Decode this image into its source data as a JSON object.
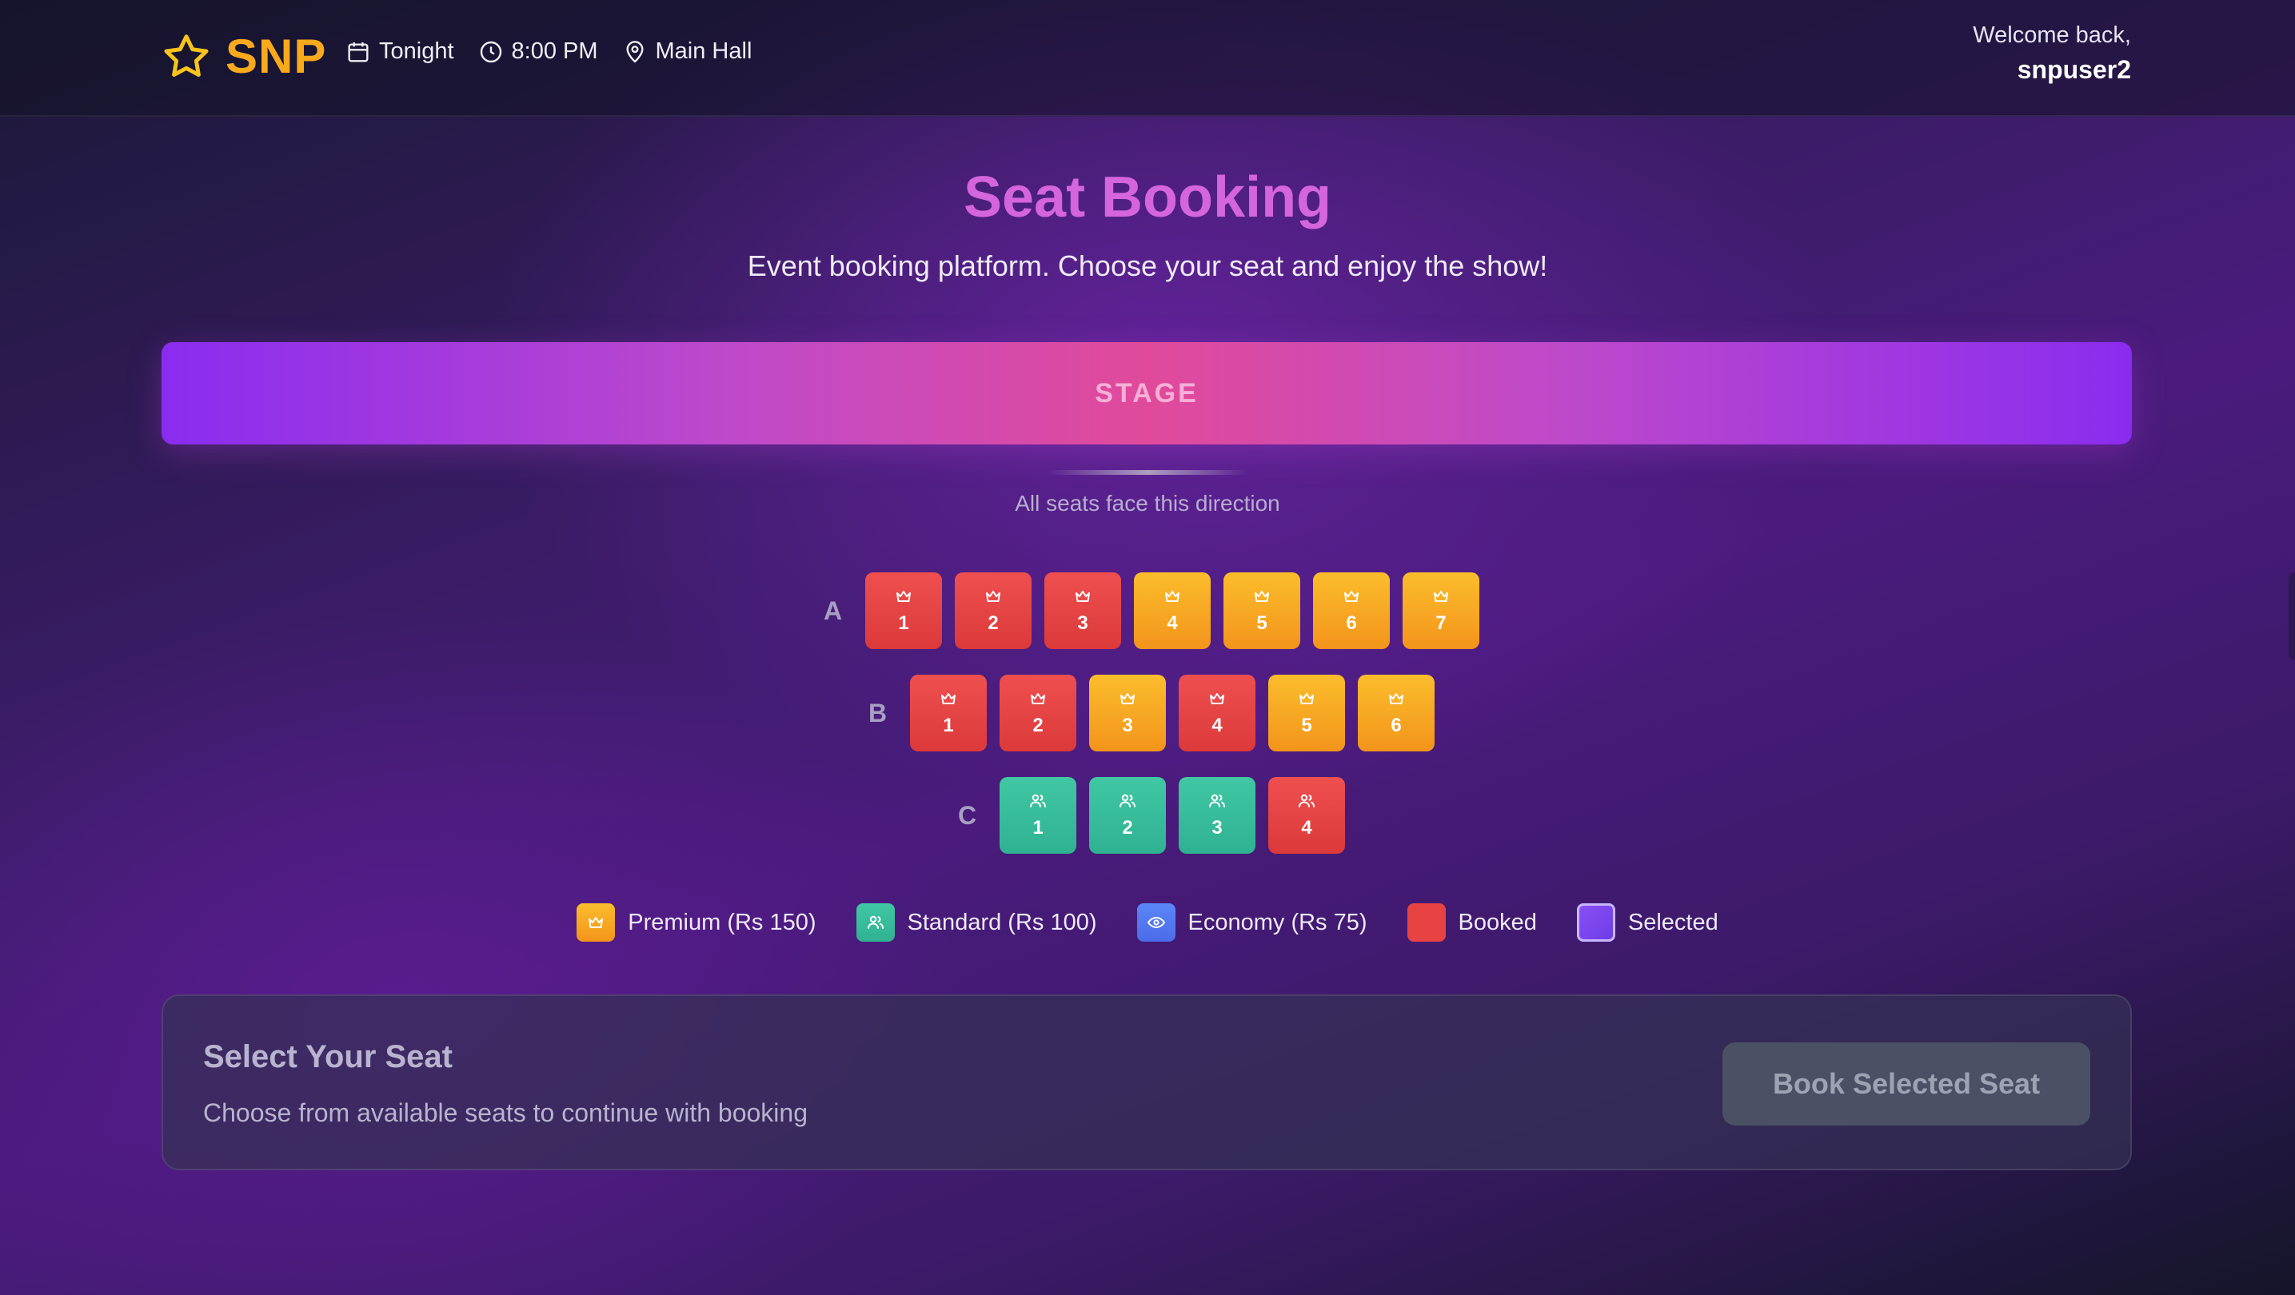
{
  "header": {
    "brand": "SNP",
    "date": "Tonight",
    "time": "8:00 PM",
    "venue": "Main Hall",
    "welcome": "Welcome back,",
    "username": "snpuser2"
  },
  "page": {
    "title": "Seat Booking",
    "subtitle": "Event booking platform. Choose your seat and enjoy the show!"
  },
  "stage": {
    "label": "STAGE",
    "note": "All seats face this direction"
  },
  "rows": [
    {
      "label": "A",
      "seats": [
        {
          "num": "1",
          "status": "booked",
          "icon": "crown-icon"
        },
        {
          "num": "2",
          "status": "booked",
          "icon": "crown-icon"
        },
        {
          "num": "3",
          "status": "booked",
          "icon": "crown-icon"
        },
        {
          "num": "4",
          "status": "premium",
          "icon": "crown-icon"
        },
        {
          "num": "5",
          "status": "premium",
          "icon": "crown-icon"
        },
        {
          "num": "6",
          "status": "premium",
          "icon": "crown-icon"
        },
        {
          "num": "7",
          "status": "premium",
          "icon": "crown-icon"
        }
      ]
    },
    {
      "label": "B",
      "seats": [
        {
          "num": "1",
          "status": "booked",
          "icon": "crown-icon"
        },
        {
          "num": "2",
          "status": "booked",
          "icon": "crown-icon"
        },
        {
          "num": "3",
          "status": "premium",
          "icon": "crown-icon"
        },
        {
          "num": "4",
          "status": "booked",
          "icon": "crown-icon"
        },
        {
          "num": "5",
          "status": "premium",
          "icon": "crown-icon"
        },
        {
          "num": "6",
          "status": "premium",
          "icon": "crown-icon"
        }
      ]
    },
    {
      "label": "C",
      "seats": [
        {
          "num": "1",
          "status": "standard",
          "icon": "users-icon"
        },
        {
          "num": "2",
          "status": "standard",
          "icon": "users-icon"
        },
        {
          "num": "3",
          "status": "standard",
          "icon": "users-icon"
        },
        {
          "num": "4",
          "status": "booked",
          "icon": "users-icon"
        }
      ]
    }
  ],
  "legend": {
    "premium": "Premium (Rs 150)",
    "standard": "Standard (Rs 100)",
    "economy": "Economy (Rs 75)",
    "booked": "Booked",
    "selected": "Selected"
  },
  "panel": {
    "title": "Select Your Seat",
    "description": "Choose from available seats to continue with booking",
    "button": "Book Selected Seat"
  },
  "colors": {
    "brand": "#f8a91c",
    "title": "#d565dc",
    "booked": "#e84343",
    "premium": "#f7a823",
    "standard": "#3bbf9d",
    "economy": "#5479f0",
    "selected": "#7b45ee"
  }
}
